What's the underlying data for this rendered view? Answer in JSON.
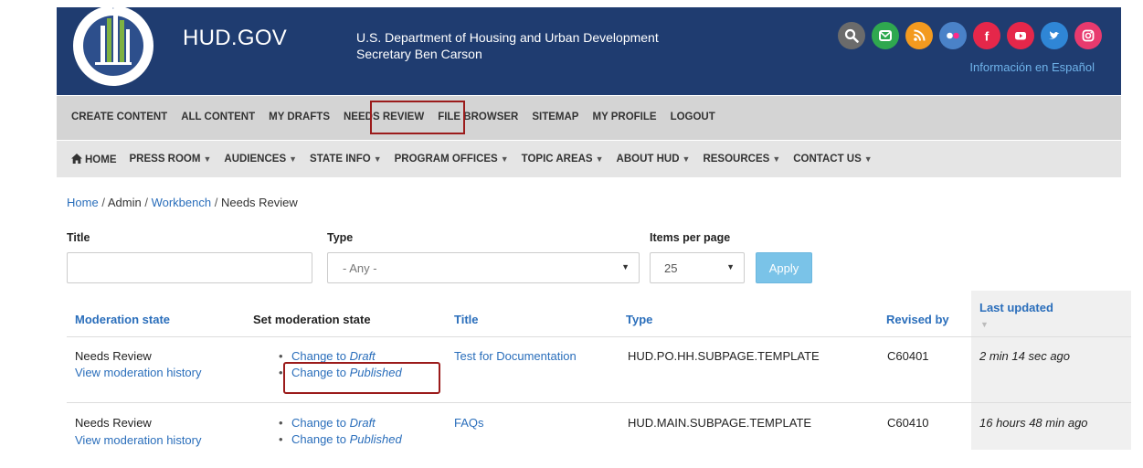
{
  "header": {
    "brand": "HUD.GOV",
    "dept_line1": "U.S. Department of Housing and Urban Development",
    "dept_line2": "Secretary Ben Carson",
    "espanol_link": "Información en Español",
    "social_icons": [
      "search-icon",
      "email-icon",
      "rss-icon",
      "flickr-icon",
      "facebook-icon",
      "youtube-icon",
      "twitter-icon",
      "instagram-icon"
    ]
  },
  "admin_menu": [
    "CREATE CONTENT",
    "ALL CONTENT",
    "MY DRAFTS",
    "NEEDS REVIEW",
    "FILE BROWSER",
    "SITEMAP",
    "MY PROFILE",
    "LOGOUT"
  ],
  "main_menu": {
    "home": "HOME",
    "items": [
      "PRESS ROOM",
      "AUDIENCES",
      "STATE INFO",
      "PROGRAM OFFICES",
      "TOPIC AREAS",
      "ABOUT HUD",
      "RESOURCES",
      "CONTACT US"
    ]
  },
  "breadcrumb": {
    "home": "Home",
    "admin": "Admin",
    "workbench": "Workbench",
    "current": "Needs Review",
    "separator": "/"
  },
  "filters": {
    "title_label": "Title",
    "title_value": "",
    "type_label": "Type",
    "type_value": "- Any -",
    "ipp_label": "Items per page",
    "ipp_value": "25",
    "apply_label": "Apply"
  },
  "table": {
    "headers": {
      "moderation_state": "Moderation state",
      "set_moderation_state": "Set moderation state",
      "title": "Title",
      "type": "Type",
      "revised_by": "Revised by",
      "last_updated": "Last updated"
    },
    "change_to": "Change to",
    "rows": [
      {
        "state": "Needs Review",
        "history_link": "View moderation history",
        "action_draft": "Draft",
        "action_published": "Published",
        "title": "Test for Documentation",
        "type": "HUD.PO.HH.SUBPAGE.TEMPLATE",
        "revised_by": "C60401",
        "last_updated": "2 min 14 sec ago"
      },
      {
        "state": "Needs Review",
        "history_link": "View moderation history",
        "action_draft": "Draft",
        "action_published": "Published",
        "title": "FAQs",
        "type": "HUD.MAIN.SUBPAGE.TEMPLATE",
        "revised_by": "C60410",
        "last_updated": "16 hours 48 min ago"
      }
    ]
  },
  "colors": {
    "header_bg": "#1f3c70",
    "admin_bar_bg": "#d4d4d4",
    "nav_bg": "#e5e5e5",
    "link": "#2a6ebb",
    "highlight_box": "#9b1b1b",
    "apply_button": "#7ac3e8"
  }
}
